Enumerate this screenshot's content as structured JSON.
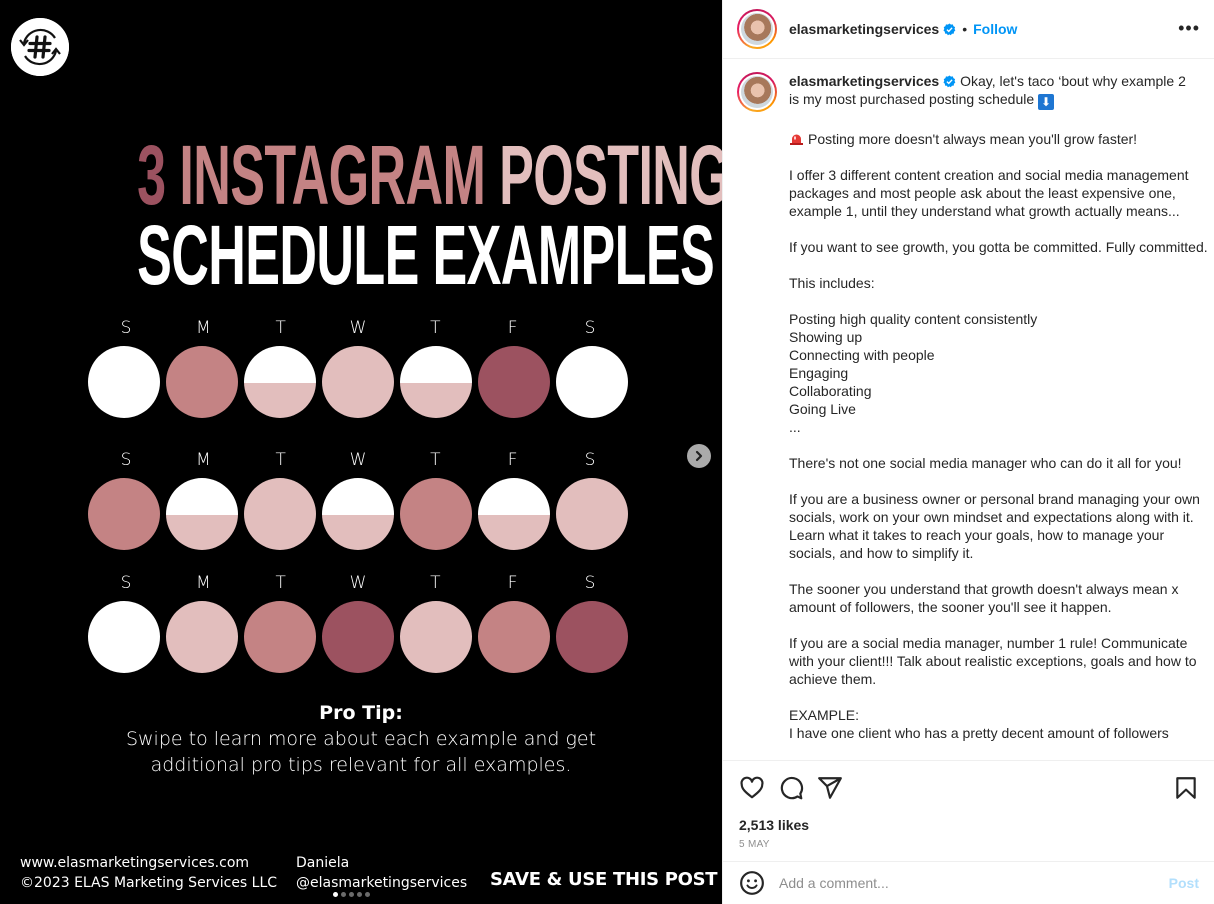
{
  "media": {
    "headline_line1": [
      {
        "text": "3 ",
        "tone": "dark"
      },
      {
        "text": "INSTAGRAM ",
        "tone": "mid"
      },
      {
        "text": "POSTING",
        "tone": "light"
      }
    ],
    "headline_line2": "SCHEDULE EXAMPLES",
    "palette": {
      "white": "#ffffff",
      "light": "#e2bebd",
      "mid": "#c48384",
      "dark": "#9c5260"
    },
    "weeks": [
      {
        "days": [
          "S",
          "M",
          "T",
          "W",
          "T",
          "F",
          "S"
        ],
        "circles": [
          {
            "top": "white",
            "bottom": "white"
          },
          {
            "top": "mid",
            "bottom": "mid"
          },
          {
            "top": "white",
            "bottom": "light"
          },
          {
            "top": "light",
            "bottom": "light"
          },
          {
            "top": "white",
            "bottom": "light"
          },
          {
            "top": "dark",
            "bottom": "dark"
          },
          {
            "top": "white",
            "bottom": "white"
          }
        ]
      },
      {
        "days": [
          "S",
          "M",
          "T",
          "W",
          "T",
          "F",
          "S"
        ],
        "circles": [
          {
            "top": "mid",
            "bottom": "mid"
          },
          {
            "top": "white",
            "bottom": "light"
          },
          {
            "top": "light",
            "bottom": "light"
          },
          {
            "top": "white",
            "bottom": "light"
          },
          {
            "top": "mid",
            "bottom": "mid"
          },
          {
            "top": "white",
            "bottom": "light"
          },
          {
            "top": "light",
            "bottom": "light"
          }
        ]
      },
      {
        "days": [
          "S",
          "M",
          "T",
          "W",
          "T",
          "F",
          "S"
        ],
        "circles": [
          {
            "top": "white",
            "bottom": "white"
          },
          {
            "top": "light",
            "bottom": "light"
          },
          {
            "top": "mid",
            "bottom": "mid"
          },
          {
            "top": "dark",
            "bottom": "dark"
          },
          {
            "top": "light",
            "bottom": "light"
          },
          {
            "top": "mid",
            "bottom": "mid"
          },
          {
            "top": "dark",
            "bottom": "dark"
          }
        ]
      }
    ],
    "pro_tip_title": "Pro Tip:",
    "pro_tip_line1": "Swipe to learn more about each example and get",
    "pro_tip_line2": "additional pro tips relevant for all examples.",
    "footer_website": "www.elasmarketingservices.com",
    "footer_copyright": "©2023 ELAS Marketing Services LLC",
    "footer_name": "Daniela",
    "footer_handle": "@elasmarketingservices",
    "footer_cta": "SAVE & USE THIS POST",
    "carousel": {
      "total": 5,
      "current": 1
    },
    "logo_icon": "hashtag-refresh-icon",
    "next_icon": "chevron-right-icon"
  },
  "header": {
    "username": "elasmarketingservices",
    "separator": "•",
    "follow_label": "Follow",
    "more_label": "•••"
  },
  "caption": {
    "username": "elasmarketingservices",
    "intro": " Okay, let's taco ‘bout why example 2 is my most purchased posting schedule ",
    "intro_emoji": "⬇",
    "siren_line": "Posting more doesn't always mean you'll grow faster!",
    "body": "\nI offer 3 different content creation and social media management packages and most people ask about the least expensive one, example 1, until they understand what growth actually means...\n\nIf you want to see growth, you gotta be committed. Fully committed.\n\nThis includes:\n\nPosting high quality content consistently\nShowing up\nConnecting with people\nEngaging\nCollaborating\nGoing Live\n...\n\nThere's not one social media manager who can do it all for you!\n\nIf you are a business owner or personal brand managing your own socials, work on your own mindset and expectations along with it. Learn what it takes to reach your goals, how to manage your socials, and how to simplify it.\n\nThe sooner you understand that growth doesn't always mean x amount of followers, the sooner you'll see it happen.\n\nIf you are a social media manager, number 1 rule! Communicate with your client!!! Talk about realistic exceptions, goals and how to achieve them.\n\nEXAMPLE:\nI have one client who has a pretty decent amount of followers"
  },
  "actions": {
    "likes": "2,513 likes",
    "date": "5 MAY"
  },
  "comment": {
    "placeholder": "Add a comment...",
    "post_label": "Post"
  },
  "colors": {
    "follow": "#0095f6",
    "post_disabled": "#b2dffc",
    "verified": "#0095f6"
  }
}
